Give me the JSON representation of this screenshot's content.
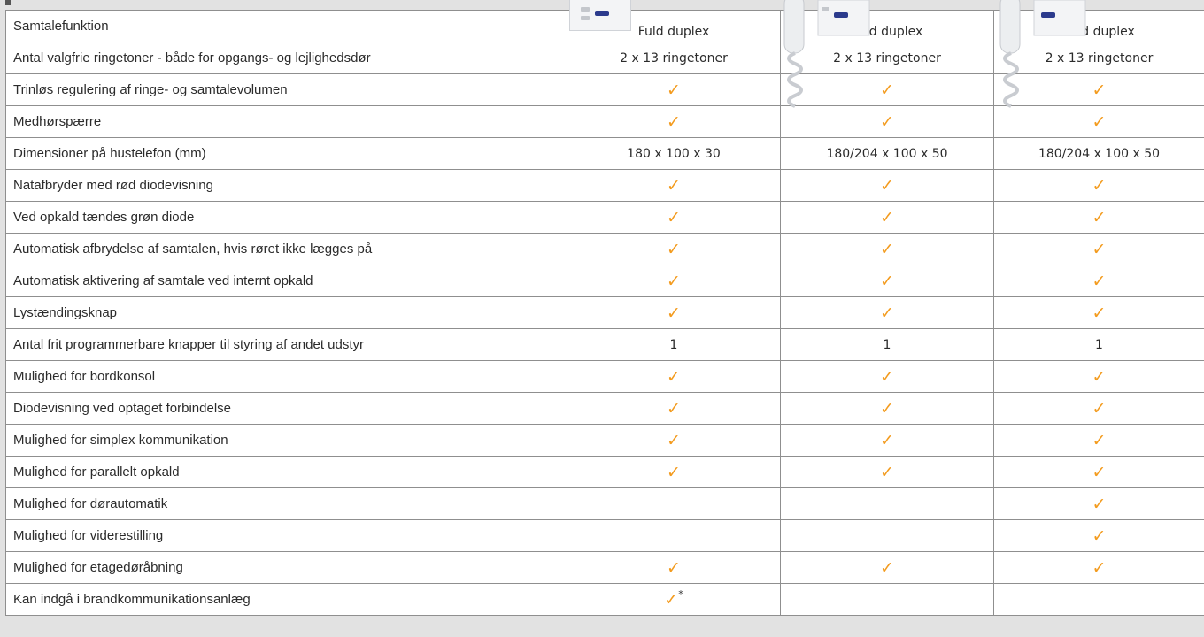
{
  "colors": {
    "check": "#f39b1e",
    "border": "#8f8f8f"
  },
  "header": {
    "label": "Samtalefunktion",
    "columns": [
      "Fuld duplex",
      "Fuld duplex",
      "Fuld duplex"
    ]
  },
  "rows": [
    {
      "label": "Antal valgfrie ringetoner - både for opgangs- og lejlighedsdør",
      "values": [
        "2 x 13 ringetoner",
        "2 x 13 ringetoner",
        "2  x 13 ringetoner"
      ]
    },
    {
      "label": "Trinløs regulering af ringe- og samtalevolumen",
      "values": [
        "✓",
        "✓",
        "✓"
      ]
    },
    {
      "label": "Medhørspærre",
      "values": [
        "✓",
        "✓",
        "✓"
      ]
    },
    {
      "label": "Dimensioner på hustelefon (mm)",
      "values": [
        "180 x 100 x 30",
        "180/204 x 100 x 50",
        "180/204 x 100 x 50"
      ]
    },
    {
      "label": "Natafbryder med rød diodevisning",
      "values": [
        "✓",
        "✓",
        "✓"
      ]
    },
    {
      "label": "Ved opkald tændes grøn diode",
      "values": [
        "✓",
        "✓",
        "✓"
      ]
    },
    {
      "label": "Automatisk afbrydelse af samtalen, hvis røret ikke lægges på",
      "values": [
        "✓",
        "✓",
        "✓"
      ]
    },
    {
      "label": "Automatisk aktivering af samtale ved internt opkald",
      "values": [
        "✓",
        "✓",
        "✓"
      ]
    },
    {
      "label": "Lystændingsknap",
      "values": [
        "✓",
        "✓",
        "✓"
      ]
    },
    {
      "label": "Antal frit programmerbare knapper til styring af andet udstyr",
      "values": [
        "1",
        "1",
        "1"
      ]
    },
    {
      "label": "Mulighed for bordkonsol",
      "values": [
        "✓",
        "✓",
        "✓"
      ]
    },
    {
      "label": "Diodevisning ved optaget forbindelse",
      "values": [
        "✓",
        "✓",
        "✓"
      ]
    },
    {
      "label": "Mulighed for simplex kommunikation",
      "values": [
        "✓",
        "✓",
        "✓"
      ]
    },
    {
      "label": "Mulighed for parallelt opkald",
      "values": [
        "✓",
        "✓",
        "✓"
      ]
    },
    {
      "label": "Mulighed for dørautomatik",
      "values": [
        "",
        "",
        "✓"
      ]
    },
    {
      "label": "Mulighed for viderestilling",
      "values": [
        "",
        "",
        "✓"
      ]
    },
    {
      "label": "Mulighed for etagedøråbning",
      "values": [
        "✓",
        "✓",
        "✓"
      ]
    },
    {
      "label": "Kan indgå i brandkommunikationsanlæg",
      "values": [
        "✓",
        "",
        ""
      ],
      "footnote": "*"
    }
  ]
}
